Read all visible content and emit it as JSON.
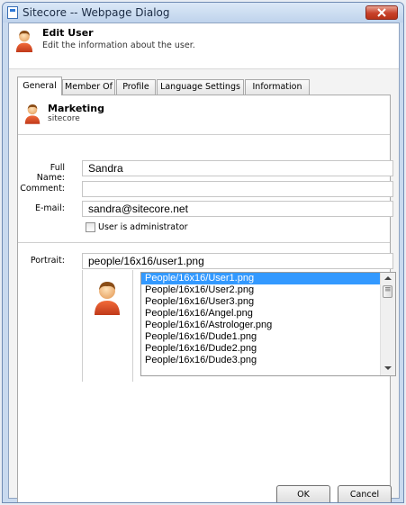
{
  "window": {
    "title": "Sitecore -- Webpage Dialog"
  },
  "header": {
    "title": "Edit User",
    "subtitle": "Edit the information about the user."
  },
  "tabs": [
    {
      "label": "General",
      "active": true
    },
    {
      "label": "Member Of",
      "active": false
    },
    {
      "label": "Profile",
      "active": false
    },
    {
      "label": "Language Settings",
      "active": false
    },
    {
      "label": "Information",
      "active": false
    }
  ],
  "user": {
    "name": "Marketing",
    "domain": "sitecore"
  },
  "form": {
    "full_name_label": "Full Name:",
    "full_name_value": "Sandra",
    "comment_label": "Comment:",
    "comment_value": "",
    "email_label": "E-mail:",
    "email_value": "sandra@sitecore.net",
    "admin_label": "User is administrator",
    "admin_checked": false,
    "portrait_label": "Portrait:",
    "portrait_value": "people/16x16/user1.png"
  },
  "portrait_list": {
    "items": [
      "People/16x16/User1.png",
      "People/16x16/User2.png",
      "People/16x16/User3.png",
      "People/16x16/Angel.png",
      "People/16x16/Astrologer.png",
      "People/16x16/Dude1.png",
      "People/16x16/Dude2.png",
      "People/16x16/Dude3.png"
    ],
    "selected_index": 0
  },
  "buttons": {
    "ok": "OK",
    "cancel": "Cancel"
  },
  "colors": {
    "accent": "#3399ff",
    "close": "#c8412a",
    "window_frame": "#c9daef"
  }
}
